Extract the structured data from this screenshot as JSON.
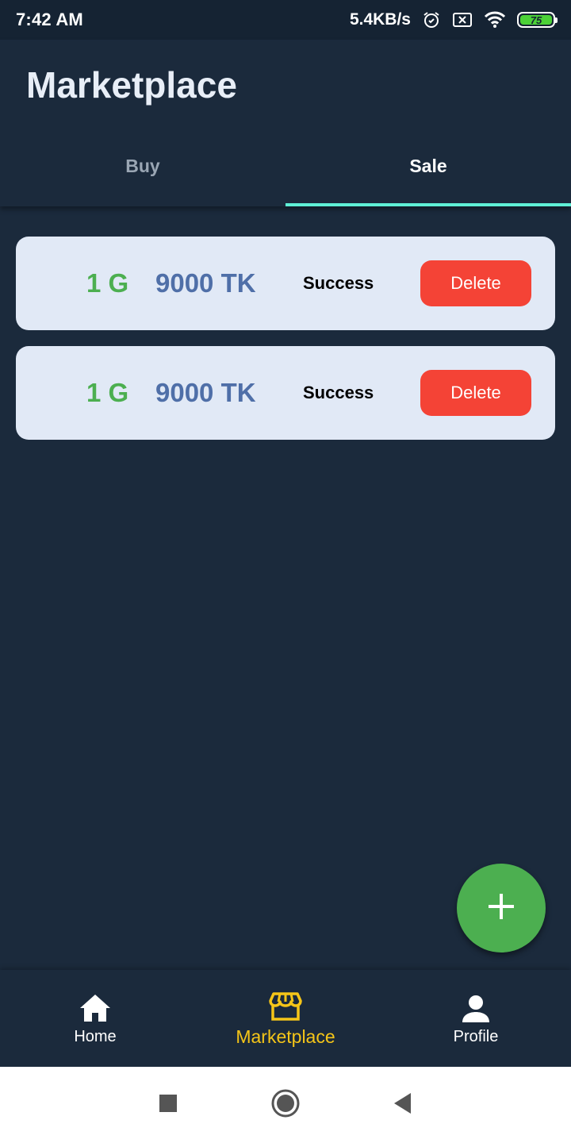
{
  "status_bar": {
    "time": "7:42 AM",
    "network_speed": "5.4KB/s",
    "battery_level": "75",
    "icons": [
      "alarm-icon",
      "sim-error-icon",
      "wifi-icon",
      "battery-icon"
    ]
  },
  "header": {
    "title": "Marketplace",
    "tabs": [
      {
        "label": "Buy",
        "active": false
      },
      {
        "label": "Sale",
        "active": true
      }
    ]
  },
  "listings": [
    {
      "amount": "1 G",
      "price": "9000 TK",
      "status": "Success",
      "action": "Delete"
    },
    {
      "amount": "1 G",
      "price": "9000 TK",
      "status": "Success",
      "action": "Delete"
    }
  ],
  "fab": {
    "icon": "plus-icon"
  },
  "bottom_nav": {
    "items": [
      {
        "label": "Home",
        "icon": "home-icon",
        "active": false
      },
      {
        "label": "Marketplace",
        "icon": "store-icon",
        "active": true
      },
      {
        "label": "Profile",
        "icon": "person-icon",
        "active": false
      }
    ]
  },
  "system_nav": {
    "icons": [
      "recents-icon",
      "home-circle-icon",
      "back-icon"
    ]
  },
  "colors": {
    "background": "#1b2a3c",
    "card": "#e1e9f6",
    "amount_green": "#4caf50",
    "price_blue": "#4f6fa8",
    "delete_red": "#f44336",
    "tab_indicator": "#5ff0d6",
    "nav_active": "#f5c518"
  }
}
